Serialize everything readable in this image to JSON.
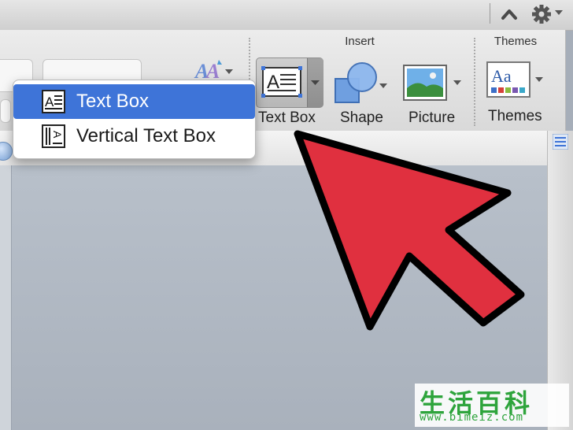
{
  "ribbon": {
    "groups": {
      "insert": {
        "title": "Insert"
      },
      "themes": {
        "title": "Themes"
      }
    },
    "buttons": {
      "text_box": {
        "label": "Text Box"
      },
      "shape": {
        "label": "Shape"
      },
      "picture": {
        "label": "Picture"
      },
      "themes": {
        "label": "Themes"
      }
    }
  },
  "dropdown": {
    "items": [
      {
        "label": "Text Box",
        "selected": true
      },
      {
        "label": "Vertical Text Box",
        "selected": false
      }
    ]
  },
  "watermark": {
    "chars": "生活百科",
    "url": "www.bimeiz.com"
  },
  "colors": {
    "selection_blue": "#3e74d8",
    "arrow_red": "#e0303f",
    "watermark_green": "#2ea43c"
  },
  "icons": [
    "caret-up-icon",
    "gear-icon",
    "text-box-icon",
    "shape-icon",
    "picture-icon",
    "themes-icon",
    "vertical-text-box-icon",
    "arrow-pointer"
  ]
}
